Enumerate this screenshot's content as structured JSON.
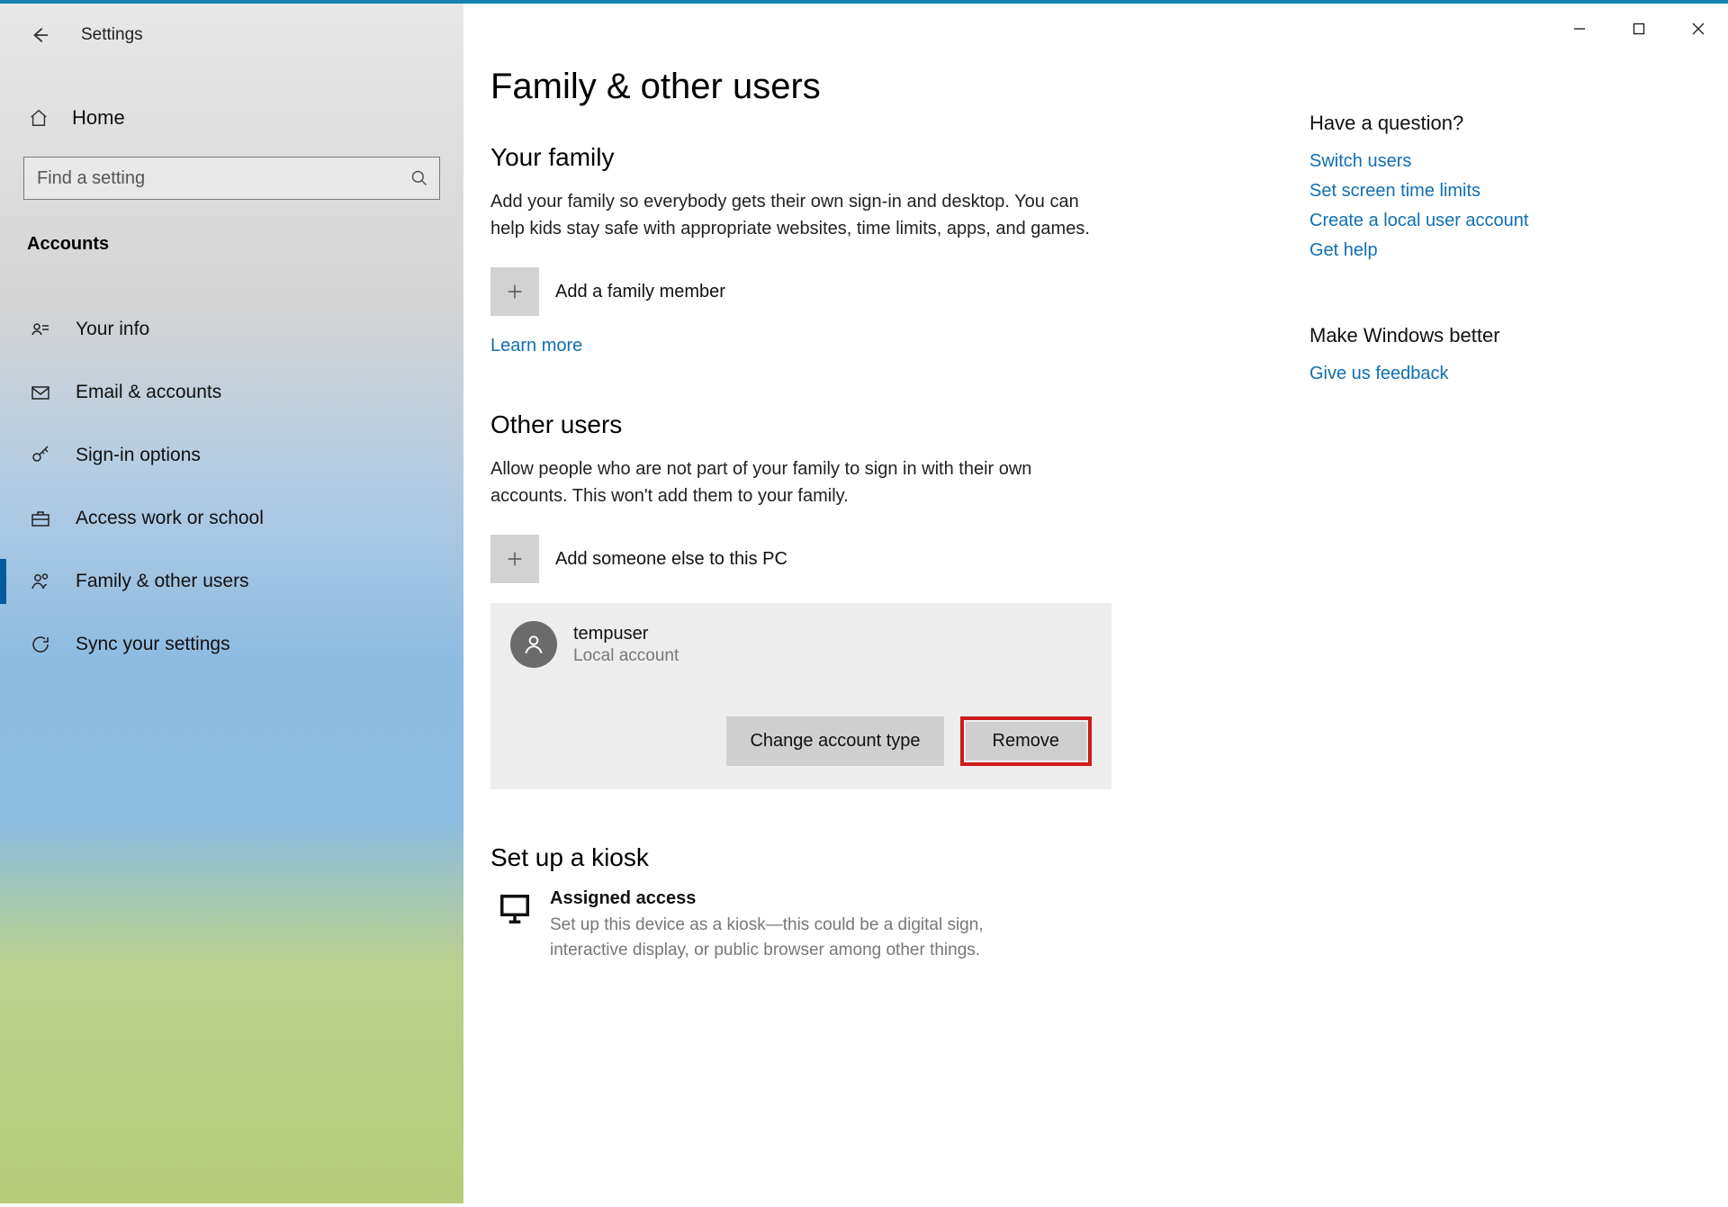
{
  "window": {
    "title": "Settings"
  },
  "sidebar": {
    "home": "Home",
    "search_placeholder": "Find a setting",
    "category": "Accounts",
    "items": [
      {
        "label": "Your info"
      },
      {
        "label": "Email & accounts"
      },
      {
        "label": "Sign-in options"
      },
      {
        "label": "Access work or school"
      },
      {
        "label": "Family & other users"
      },
      {
        "label": "Sync your settings"
      }
    ]
  },
  "main": {
    "page_title": "Family & other users",
    "family": {
      "heading": "Your family",
      "desc": "Add your family so everybody gets their own sign-in and desktop. You can help kids stay safe with appropriate websites, time limits, apps, and games.",
      "add_label": "Add a family member",
      "learn_more": "Learn more"
    },
    "other": {
      "heading": "Other users",
      "desc": "Allow people who are not part of your family to sign in with their own accounts. This won't add them to your family.",
      "add_label": "Add someone else to this PC",
      "user": {
        "name": "tempuser",
        "type": "Local account"
      },
      "change_btn": "Change account type",
      "remove_btn": "Remove"
    },
    "kiosk": {
      "heading": "Set up a kiosk",
      "title": "Assigned access",
      "desc": "Set up this device as a kiosk—this could be a digital sign, interactive display, or public browser among other things."
    }
  },
  "side": {
    "question": {
      "heading": "Have a question?",
      "links": [
        "Switch users",
        "Set screen time limits",
        "Create a local user account",
        "Get help"
      ]
    },
    "feedback": {
      "heading": "Make Windows better",
      "link": "Give us feedback"
    }
  }
}
